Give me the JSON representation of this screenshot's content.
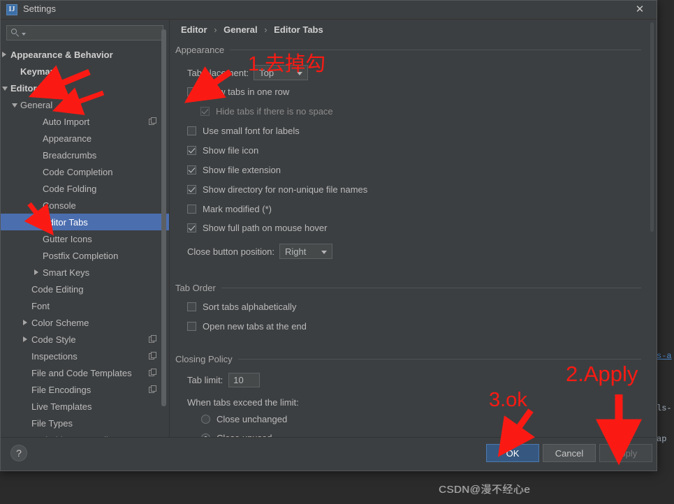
{
  "window": {
    "title": "Settings",
    "icon": "intellij-idea-icon",
    "close_label": "✕"
  },
  "search": {
    "value": "",
    "placeholder": ""
  },
  "sidebar": {
    "items": [
      {
        "label": "Appearance & Behavior",
        "indent": 0,
        "arrow": "right",
        "bold": true,
        "selected": false,
        "copy": false
      },
      {
        "label": "Keymap",
        "indent": 1,
        "arrow": "none",
        "bold": true,
        "selected": false,
        "copy": false
      },
      {
        "label": "Editor",
        "indent": 0,
        "arrow": "down",
        "bold": true,
        "selected": false,
        "copy": false
      },
      {
        "label": "General",
        "indent": 1,
        "arrow": "down",
        "bold": false,
        "selected": false,
        "copy": false
      },
      {
        "label": "Auto Import",
        "indent": 3,
        "arrow": "none",
        "bold": false,
        "selected": false,
        "copy": true
      },
      {
        "label": "Appearance",
        "indent": 3,
        "arrow": "none",
        "bold": false,
        "selected": false,
        "copy": false
      },
      {
        "label": "Breadcrumbs",
        "indent": 3,
        "arrow": "none",
        "bold": false,
        "selected": false,
        "copy": false
      },
      {
        "label": "Code Completion",
        "indent": 3,
        "arrow": "none",
        "bold": false,
        "selected": false,
        "copy": false
      },
      {
        "label": "Code Folding",
        "indent": 3,
        "arrow": "none",
        "bold": false,
        "selected": false,
        "copy": false
      },
      {
        "label": "Console",
        "indent": 3,
        "arrow": "none",
        "bold": false,
        "selected": false,
        "copy": false
      },
      {
        "label": "Editor Tabs",
        "indent": 3,
        "arrow": "none",
        "bold": false,
        "selected": true,
        "copy": false
      },
      {
        "label": "Gutter Icons",
        "indent": 3,
        "arrow": "none",
        "bold": false,
        "selected": false,
        "copy": false
      },
      {
        "label": "Postfix Completion",
        "indent": 3,
        "arrow": "none",
        "bold": false,
        "selected": false,
        "copy": false
      },
      {
        "label": "Smart Keys",
        "indent": 3,
        "arrow": "right",
        "bold": false,
        "selected": false,
        "copy": false
      },
      {
        "label": "Code Editing",
        "indent": 2,
        "arrow": "none",
        "bold": false,
        "selected": false,
        "copy": false
      },
      {
        "label": "Font",
        "indent": 2,
        "arrow": "none",
        "bold": false,
        "selected": false,
        "copy": false
      },
      {
        "label": "Color Scheme",
        "indent": 2,
        "arrow": "right",
        "bold": false,
        "selected": false,
        "copy": false
      },
      {
        "label": "Code Style",
        "indent": 2,
        "arrow": "right",
        "bold": false,
        "selected": false,
        "copy": true
      },
      {
        "label": "Inspections",
        "indent": 2,
        "arrow": "none",
        "bold": false,
        "selected": false,
        "copy": true
      },
      {
        "label": "File and Code Templates",
        "indent": 2,
        "arrow": "none",
        "bold": false,
        "selected": false,
        "copy": true
      },
      {
        "label": "File Encodings",
        "indent": 2,
        "arrow": "none",
        "bold": false,
        "selected": false,
        "copy": true
      },
      {
        "label": "Live Templates",
        "indent": 2,
        "arrow": "none",
        "bold": false,
        "selected": false,
        "copy": false
      },
      {
        "label": "File Types",
        "indent": 2,
        "arrow": "none",
        "bold": false,
        "selected": false,
        "copy": false
      },
      {
        "label": "Android Layout Editor",
        "indent": 2,
        "arrow": "none",
        "bold": false,
        "selected": false,
        "copy": false
      }
    ]
  },
  "breadcrumb": {
    "parts": [
      "Editor",
      "General",
      "Editor Tabs"
    ],
    "separator": "›"
  },
  "appearance_group": {
    "title": "Appearance",
    "tab_placement_label": "Tab placement:",
    "tab_placement_value": "Top",
    "checkboxes": [
      {
        "label": "Show tabs in one row",
        "checked": false,
        "disabled": false,
        "indent": 0
      },
      {
        "label": "Hide tabs if there is no space",
        "checked": true,
        "disabled": true,
        "indent": 1
      },
      {
        "label": "Use small font for labels",
        "checked": false,
        "disabled": false,
        "indent": 0
      },
      {
        "label": "Show file icon",
        "checked": true,
        "disabled": false,
        "indent": 0
      },
      {
        "label": "Show file extension",
        "checked": true,
        "disabled": false,
        "indent": 0
      },
      {
        "label": "Show directory for non-unique file names",
        "checked": true,
        "disabled": false,
        "indent": 0
      },
      {
        "label": "Mark modified (*)",
        "checked": false,
        "disabled": false,
        "indent": 0
      },
      {
        "label": "Show full path on mouse hover",
        "checked": true,
        "disabled": false,
        "indent": 0
      }
    ],
    "close_button_label": "Close button position:",
    "close_button_value": "Right"
  },
  "tab_order_group": {
    "title": "Tab Order",
    "checkboxes": [
      {
        "label": "Sort tabs alphabetically",
        "checked": false
      },
      {
        "label": "Open new tabs at the end",
        "checked": false
      }
    ]
  },
  "closing_policy_group": {
    "title": "Closing Policy",
    "tab_limit_label": "Tab limit:",
    "tab_limit_value": "10",
    "when_exceed_label": "When tabs exceed the limit:",
    "radios": [
      {
        "label": "Close unchanged",
        "checked": false
      },
      {
        "label": "Close unused",
        "checked": true
      }
    ]
  },
  "footer": {
    "help_label": "?",
    "ok_label": "OK",
    "cancel_label": "Cancel",
    "apply_label": "Apply"
  },
  "annotations": [
    {
      "id": "anno-1",
      "text": "1.去掉勾"
    },
    {
      "id": "anno-2",
      "text": "2.Apply"
    },
    {
      "id": "anno-3",
      "text": "3.ok"
    }
  ],
  "background_text": {
    "line1": "s-a",
    "line2": "ls-",
    "line3": "ap"
  },
  "watermark": "CSDN@漫不经心e",
  "colors": {
    "accent_blue": "#4b6eaf",
    "primary_button": "#365880",
    "annotation_red": "#fb1a13",
    "panel_bg": "#3c3f41",
    "ide_bg": "#2b2b2b",
    "text": "#bbbbbb",
    "link_blue": "#4e86c7"
  }
}
